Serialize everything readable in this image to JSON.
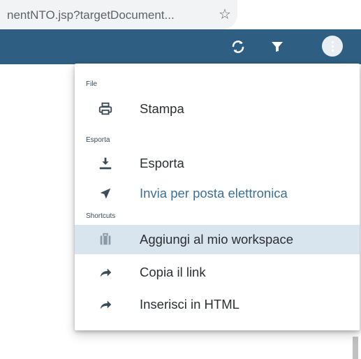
{
  "browser": {
    "address_text": "nentNTO.jsp?targetDocument...",
    "bookmark_icon": "star-outline-icon"
  },
  "toolbar": {
    "background": "#2e5f82",
    "icons": [
      "refresh-icon",
      "filter-icon",
      "more-vertical-icon"
    ]
  },
  "menu": {
    "sections": {
      "file": "File",
      "esporta": "Esporta",
      "shortcuts": "Shortcuts"
    },
    "items": {
      "stampa": "Stampa",
      "esporta": "Esporta",
      "invia": "Invia per posta elettronica",
      "aggiungi": "Aggiungi al mio workspace",
      "copia": "Copia il link",
      "inserisci": "Inserisci in HTML"
    },
    "colors": {
      "hover_bg": "#d8e4ee",
      "link_text": "#3c6f9a",
      "icon": "#3a4a57"
    }
  }
}
